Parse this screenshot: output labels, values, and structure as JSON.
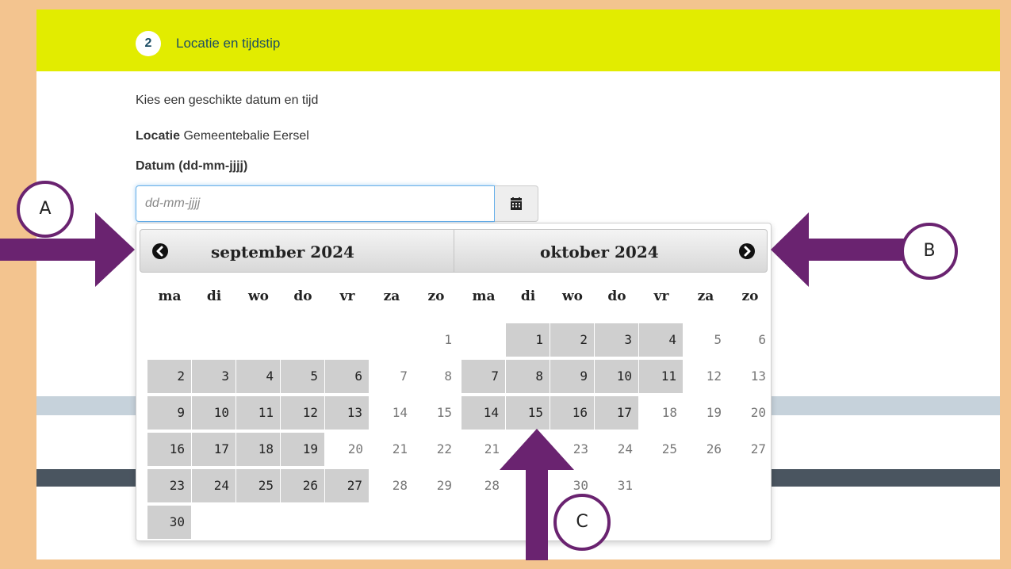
{
  "step": {
    "number": "2",
    "title": "Locatie en tijdstip"
  },
  "intro_text": "Kies een geschikte datum en tijd",
  "location": {
    "label": "Locatie",
    "value": "Gemeentebalie Eersel"
  },
  "date_field": {
    "label": "Datum (dd-mm-jjjj)",
    "placeholder": "dd-mm-jjjj",
    "value": ""
  },
  "colors": {
    "step_header": "#e2ec00",
    "page_border": "#f3c48f",
    "arrow": "#6a2370",
    "available_day": "#cfcfcf"
  },
  "icons": {
    "calendar": "calendar-icon",
    "prev": "chevron-circle-left-icon",
    "next": "chevron-circle-right-icon"
  },
  "datepicker": {
    "weekdays": [
      "ma",
      "di",
      "wo",
      "do",
      "vr",
      "za",
      "zo"
    ],
    "months": [
      {
        "title": "september 2024",
        "first_weekday_index": 6,
        "days_in_month": 30,
        "available": [
          2,
          3,
          4,
          5,
          6,
          9,
          10,
          11,
          12,
          13,
          16,
          17,
          18,
          19,
          23,
          24,
          25,
          26,
          27,
          30
        ]
      },
      {
        "title": "oktober 2024",
        "first_weekday_index": 1,
        "days_in_month": 31,
        "available": [
          1,
          2,
          3,
          4,
          7,
          8,
          9,
          10,
          11,
          14,
          15,
          16,
          17
        ]
      }
    ]
  },
  "markers": {
    "a": "A",
    "b": "B",
    "c": "C"
  }
}
